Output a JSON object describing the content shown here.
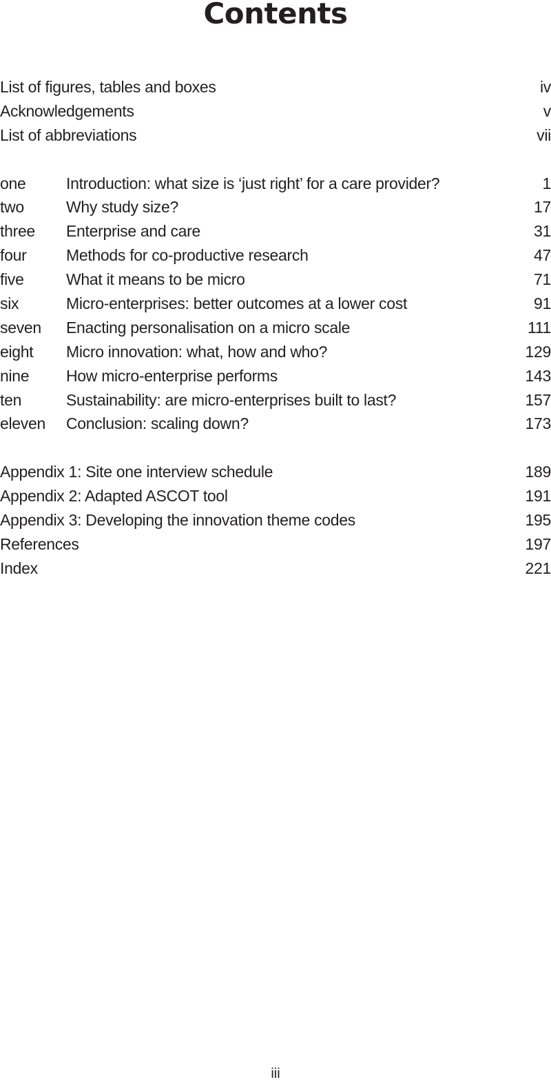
{
  "title": "Contents",
  "front_matter": [
    {
      "label": "List of figures, tables and boxes",
      "page": "iv"
    },
    {
      "label": "Acknowledgements",
      "page": "v"
    },
    {
      "label": "List of abbreviations",
      "page": "vii"
    }
  ],
  "chapters": [
    {
      "number": "one",
      "label": "Introduction: what size is ‘just right’ for a care provider?",
      "page": "1"
    },
    {
      "number": "two",
      "label": "Why study size?",
      "page": "17"
    },
    {
      "number": "three",
      "label": "Enterprise and care",
      "page": "31"
    },
    {
      "number": "four",
      "label": "Methods for co-productive research",
      "page": "47"
    },
    {
      "number": "five",
      "label": "What it means to be micro",
      "page": "71"
    },
    {
      "number": "six",
      "label": "Micro-enterprises: better outcomes at a lower cost",
      "page": "91"
    },
    {
      "number": "seven",
      "label": "Enacting personalisation on a micro scale",
      "page": "111"
    },
    {
      "number": "eight",
      "label": "Micro innovation: what, how and who?",
      "page": "129"
    },
    {
      "number": "nine",
      "label": "How micro-enterprise performs",
      "page": "143"
    },
    {
      "number": "ten",
      "label": "Sustainability: are micro-enterprises built to last?",
      "page": "157"
    },
    {
      "number": "eleven",
      "label": "Conclusion: scaling down?",
      "page": "173"
    }
  ],
  "back_matter": [
    {
      "label": "Appendix 1: Site one interview schedule",
      "page": "189"
    },
    {
      "label": "Appendix 2: Adapted ASCOT tool",
      "page": "191"
    },
    {
      "label": "Appendix 3: Developing the innovation theme codes",
      "page": "195"
    },
    {
      "label": "References",
      "page": "197"
    },
    {
      "label": "Index",
      "page": "221"
    }
  ],
  "folio": "iii"
}
